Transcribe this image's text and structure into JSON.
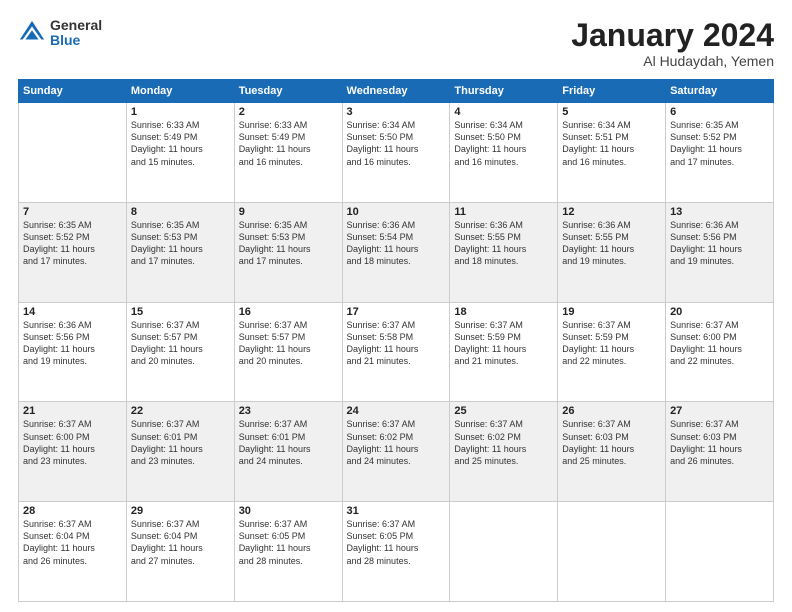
{
  "logo": {
    "general": "General",
    "blue": "Blue"
  },
  "title": {
    "month": "January 2024",
    "location": "Al Hudaydah, Yemen"
  },
  "days_of_week": [
    "Sunday",
    "Monday",
    "Tuesday",
    "Wednesday",
    "Thursday",
    "Friday",
    "Saturday"
  ],
  "weeks": [
    [
      {
        "day": "",
        "info": ""
      },
      {
        "day": "1",
        "info": "Sunrise: 6:33 AM\nSunset: 5:49 PM\nDaylight: 11 hours\nand 15 minutes."
      },
      {
        "day": "2",
        "info": "Sunrise: 6:33 AM\nSunset: 5:49 PM\nDaylight: 11 hours\nand 16 minutes."
      },
      {
        "day": "3",
        "info": "Sunrise: 6:34 AM\nSunset: 5:50 PM\nDaylight: 11 hours\nand 16 minutes."
      },
      {
        "day": "4",
        "info": "Sunrise: 6:34 AM\nSunset: 5:50 PM\nDaylight: 11 hours\nand 16 minutes."
      },
      {
        "day": "5",
        "info": "Sunrise: 6:34 AM\nSunset: 5:51 PM\nDaylight: 11 hours\nand 16 minutes."
      },
      {
        "day": "6",
        "info": "Sunrise: 6:35 AM\nSunset: 5:52 PM\nDaylight: 11 hours\nand 17 minutes."
      }
    ],
    [
      {
        "day": "7",
        "info": "Sunrise: 6:35 AM\nSunset: 5:52 PM\nDaylight: 11 hours\nand 17 minutes."
      },
      {
        "day": "8",
        "info": "Sunrise: 6:35 AM\nSunset: 5:53 PM\nDaylight: 11 hours\nand 17 minutes."
      },
      {
        "day": "9",
        "info": "Sunrise: 6:35 AM\nSunset: 5:53 PM\nDaylight: 11 hours\nand 17 minutes."
      },
      {
        "day": "10",
        "info": "Sunrise: 6:36 AM\nSunset: 5:54 PM\nDaylight: 11 hours\nand 18 minutes."
      },
      {
        "day": "11",
        "info": "Sunrise: 6:36 AM\nSunset: 5:55 PM\nDaylight: 11 hours\nand 18 minutes."
      },
      {
        "day": "12",
        "info": "Sunrise: 6:36 AM\nSunset: 5:55 PM\nDaylight: 11 hours\nand 19 minutes."
      },
      {
        "day": "13",
        "info": "Sunrise: 6:36 AM\nSunset: 5:56 PM\nDaylight: 11 hours\nand 19 minutes."
      }
    ],
    [
      {
        "day": "14",
        "info": "Sunrise: 6:36 AM\nSunset: 5:56 PM\nDaylight: 11 hours\nand 19 minutes."
      },
      {
        "day": "15",
        "info": "Sunrise: 6:37 AM\nSunset: 5:57 PM\nDaylight: 11 hours\nand 20 minutes."
      },
      {
        "day": "16",
        "info": "Sunrise: 6:37 AM\nSunset: 5:57 PM\nDaylight: 11 hours\nand 20 minutes."
      },
      {
        "day": "17",
        "info": "Sunrise: 6:37 AM\nSunset: 5:58 PM\nDaylight: 11 hours\nand 21 minutes."
      },
      {
        "day": "18",
        "info": "Sunrise: 6:37 AM\nSunset: 5:59 PM\nDaylight: 11 hours\nand 21 minutes."
      },
      {
        "day": "19",
        "info": "Sunrise: 6:37 AM\nSunset: 5:59 PM\nDaylight: 11 hours\nand 22 minutes."
      },
      {
        "day": "20",
        "info": "Sunrise: 6:37 AM\nSunset: 6:00 PM\nDaylight: 11 hours\nand 22 minutes."
      }
    ],
    [
      {
        "day": "21",
        "info": "Sunrise: 6:37 AM\nSunset: 6:00 PM\nDaylight: 11 hours\nand 23 minutes."
      },
      {
        "day": "22",
        "info": "Sunrise: 6:37 AM\nSunset: 6:01 PM\nDaylight: 11 hours\nand 23 minutes."
      },
      {
        "day": "23",
        "info": "Sunrise: 6:37 AM\nSunset: 6:01 PM\nDaylight: 11 hours\nand 24 minutes."
      },
      {
        "day": "24",
        "info": "Sunrise: 6:37 AM\nSunset: 6:02 PM\nDaylight: 11 hours\nand 24 minutes."
      },
      {
        "day": "25",
        "info": "Sunrise: 6:37 AM\nSunset: 6:02 PM\nDaylight: 11 hours\nand 25 minutes."
      },
      {
        "day": "26",
        "info": "Sunrise: 6:37 AM\nSunset: 6:03 PM\nDaylight: 11 hours\nand 25 minutes."
      },
      {
        "day": "27",
        "info": "Sunrise: 6:37 AM\nSunset: 6:03 PM\nDaylight: 11 hours\nand 26 minutes."
      }
    ],
    [
      {
        "day": "28",
        "info": "Sunrise: 6:37 AM\nSunset: 6:04 PM\nDaylight: 11 hours\nand 26 minutes."
      },
      {
        "day": "29",
        "info": "Sunrise: 6:37 AM\nSunset: 6:04 PM\nDaylight: 11 hours\nand 27 minutes."
      },
      {
        "day": "30",
        "info": "Sunrise: 6:37 AM\nSunset: 6:05 PM\nDaylight: 11 hours\nand 28 minutes."
      },
      {
        "day": "31",
        "info": "Sunrise: 6:37 AM\nSunset: 6:05 PM\nDaylight: 11 hours\nand 28 minutes."
      },
      {
        "day": "",
        "info": ""
      },
      {
        "day": "",
        "info": ""
      },
      {
        "day": "",
        "info": ""
      }
    ]
  ]
}
